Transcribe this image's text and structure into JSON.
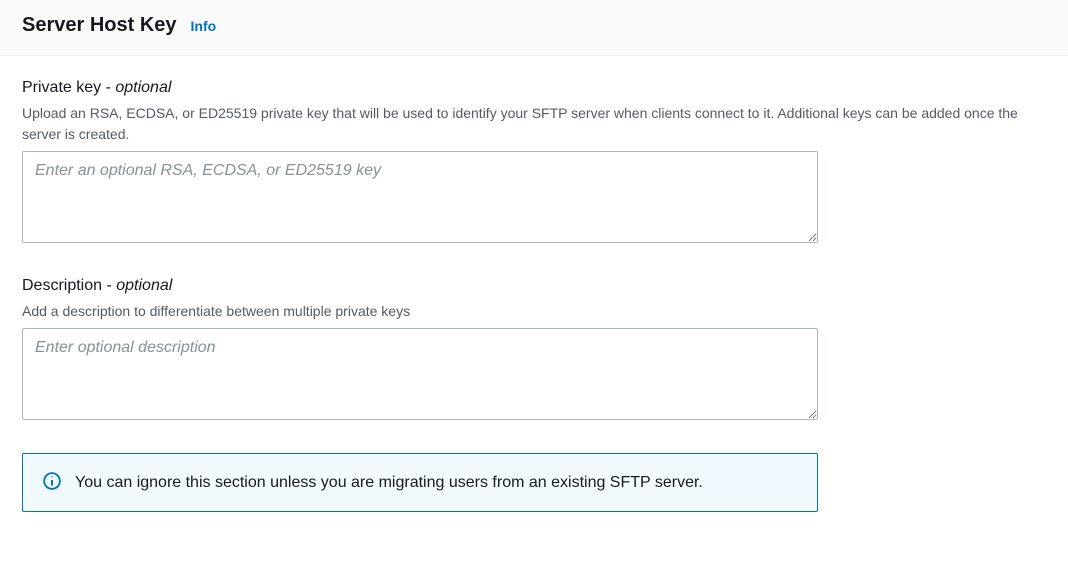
{
  "header": {
    "title": "Server Host Key",
    "info_link": "Info"
  },
  "fields": {
    "private_key": {
      "label_main": "Private key - ",
      "label_optional": "optional",
      "help": "Upload an RSA, ECDSA, or ED25519 private key that will be used to identify your SFTP server when clients connect to it. Additional keys can be added once the server is created.",
      "placeholder": "Enter an optional RSA, ECDSA, or ED25519 key",
      "value": ""
    },
    "description": {
      "label_main": "Description - ",
      "label_optional": "optional",
      "help": "Add a description to differentiate between multiple private keys",
      "placeholder": "Enter optional description",
      "value": ""
    }
  },
  "info_box": {
    "message": "You can ignore this section unless you are migrating users from an existing SFTP server."
  }
}
